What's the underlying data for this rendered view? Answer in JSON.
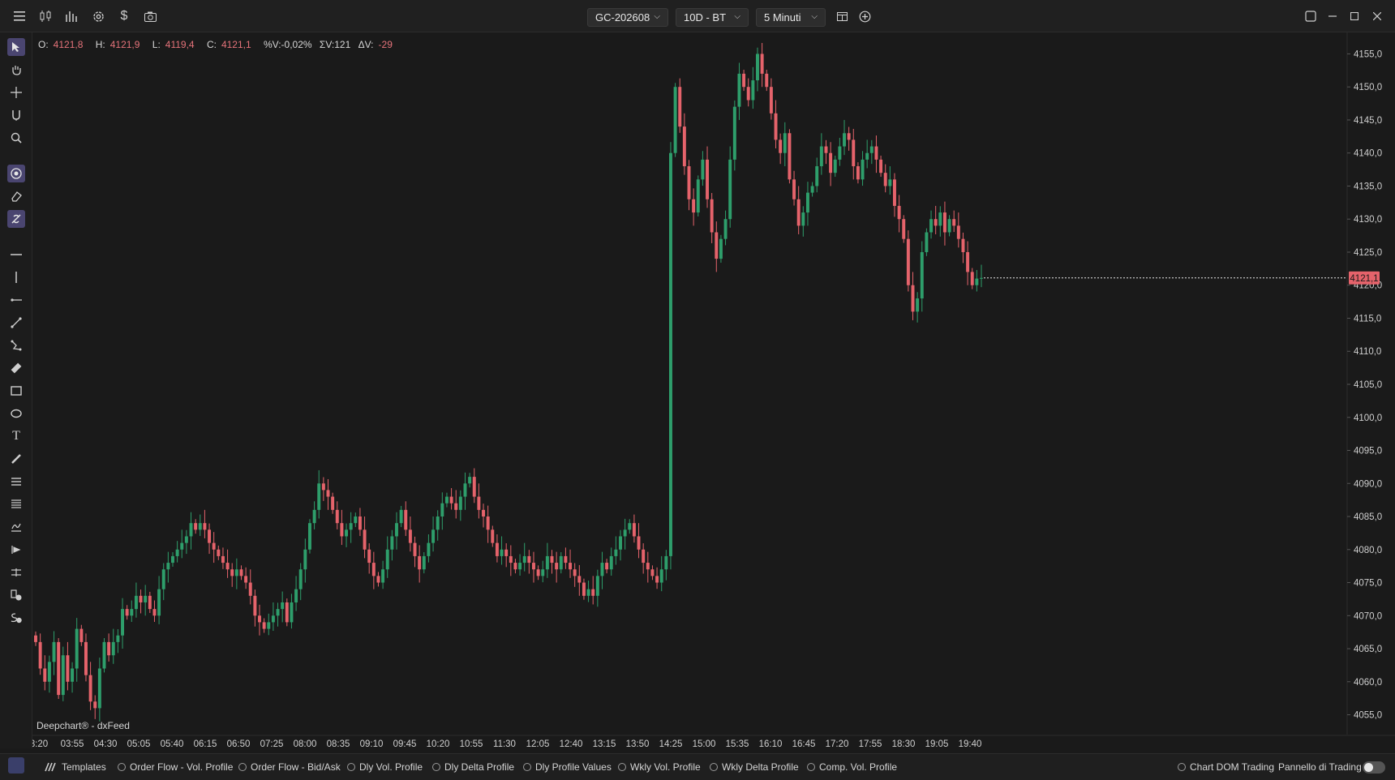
{
  "toolbar": {
    "icons": [
      "menu-icon",
      "candle-type-icon",
      "bar-chart-icon",
      "settings-icon",
      "dollar-icon",
      "camera-icon"
    ],
    "symbol": "GC-202608",
    "range": "10D - BT",
    "interval": "5 Minuti",
    "extra_icons": [
      "layout-icon",
      "add-icon"
    ],
    "window_icons": [
      "restore-icon",
      "minimize-icon",
      "maximize-icon",
      "close-icon"
    ]
  },
  "ohlc": {
    "o_label": "O:",
    "o": "4121,8",
    "h_label": "H:",
    "h": "4121,9",
    "l_label": "L:",
    "l": "4119,4",
    "c_label": "C:",
    "c": "4121,1",
    "pv": "%V:-0,02%",
    "sv": "ΣV:121",
    "dv_label": "ΔV:",
    "dv": "-29"
  },
  "brand": "Deepchart® - dxFeed",
  "colors": {
    "up": "#2e9e6b",
    "down": "#e5636b",
    "bg": "#1a1a1a",
    "accent": "#8a7fd0"
  },
  "chart_data": {
    "type": "candlestick",
    "ylim": [
      4052,
      4158
    ],
    "y_ticks": [
      "4055,0",
      "4060,0",
      "4065,0",
      "4070,0",
      "4075,0",
      "4080,0",
      "4085,0",
      "4090,0",
      "4095,0",
      "4100,0",
      "4105,0",
      "4110,0",
      "4115,0",
      "4120,0",
      "4125,0",
      "4130,0",
      "4135,0",
      "4140,0",
      "4145,0",
      "4150,0",
      "4155,0"
    ],
    "x_ticks": [
      "3:20",
      "03:55",
      "04:30",
      "05:05",
      "05:40",
      "06:15",
      "06:50",
      "07:25",
      "08:00",
      "08:35",
      "09:10",
      "09:45",
      "10:20",
      "10:55",
      "11:30",
      "12:05",
      "12:40",
      "13:15",
      "13:50",
      "14:25",
      "15:00",
      "15:35",
      "16:10",
      "16:45",
      "17:20",
      "17:55",
      "18:30",
      "19:05",
      "19:40"
    ],
    "last_price": "4121,1",
    "last_price_value": 4121.1,
    "closes": [
      4066,
      4062,
      4060,
      4063,
      4066,
      4058,
      4064,
      4060,
      4062,
      4068,
      4066,
      4061,
      4057,
      4056,
      4062,
      4066,
      4064,
      4066,
      4067,
      4071,
      4070,
      4071,
      4073,
      4072,
      4073,
      4071,
      4070,
      4074,
      4077,
      4078,
      4079,
      4080,
      4081,
      4082,
      4084,
      4083,
      4084,
      4083,
      4081,
      4080,
      4079,
      4078,
      4077,
      4076,
      4077,
      4076,
      4075,
      4073,
      4070,
      4069,
      4068,
      4069,
      4070,
      4071,
      4072,
      4069,
      4072,
      4074,
      4077,
      4080,
      4084,
      4086,
      4090,
      4089,
      4088,
      4086,
      4084,
      4082,
      4083,
      4084,
      4085,
      4083,
      4080,
      4078,
      4076,
      4075,
      4077,
      4080,
      4082,
      4084,
      4086,
      4083,
      4081,
      4079,
      4077,
      4079,
      4081,
      4083,
      4085,
      4087,
      4088,
      4087,
      4086,
      4088,
      4090,
      4091,
      4088,
      4086,
      4085,
      4083,
      4081,
      4079,
      4080,
      4079,
      4078,
      4077,
      4078,
      4079,
      4078,
      4077,
      4076,
      4077,
      4079,
      4078,
      4077,
      4079,
      4078,
      4077,
      4076,
      4075,
      4073,
      4074,
      4073,
      4076,
      4078,
      4077,
      4079,
      4080,
      4082,
      4083,
      4084,
      4082,
      4080,
      4078,
      4077,
      4076,
      4075,
      4077,
      4079,
      4140,
      4150,
      4144,
      4138,
      4133,
      4131,
      4136,
      4139,
      4133,
      4128,
      4124,
      4127,
      4130,
      4139,
      4147,
      4152,
      4150,
      4148,
      4151,
      4155,
      4152,
      4150,
      4146,
      4142,
      4140,
      4143,
      4136,
      4133,
      4129,
      4131,
      4134,
      4135,
      4138,
      4141,
      4140,
      4137,
      4139,
      4141,
      4143,
      4142,
      4138,
      4136,
      4139,
      4140,
      4141,
      4139,
      4137,
      4135,
      4136,
      4132,
      4130,
      4127,
      4120,
      4116,
      4118,
      4125,
      4128,
      4130,
      4129,
      4131,
      4128,
      4130,
      4129,
      4127,
      4125,
      4122,
      4120,
      4121,
      4121.1
    ]
  },
  "bottombar": {
    "templates": "Templates",
    "items": [
      "Order Flow - Vol. Profile",
      "Order Flow - Bid/Ask",
      "Dly Vol. Profile",
      "Dly Delta Profile",
      "Dly Profile Values",
      "Wkly Vol. Profile",
      "Wkly Delta Profile",
      "Comp. Vol. Profile"
    ],
    "chart_dom": "Chart DOM Trading",
    "panel": "Pannello di Trading"
  }
}
